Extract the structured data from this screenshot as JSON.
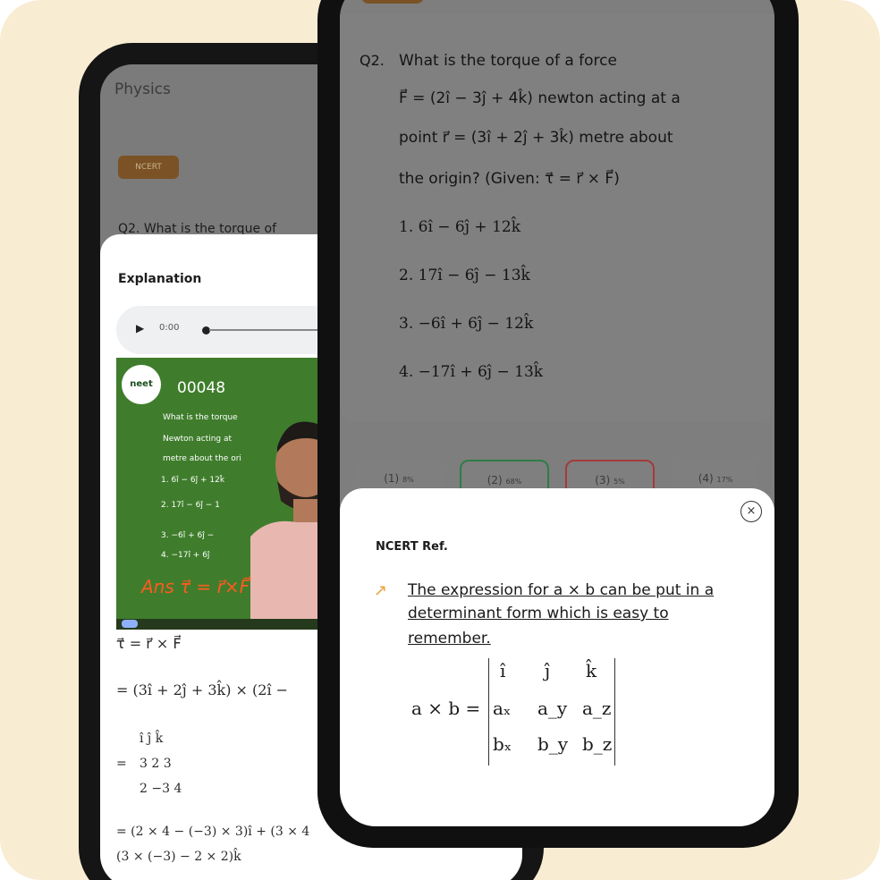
{
  "back_phone": {
    "title": "Physics",
    "badge": "NCERT",
    "question_preview": "Q2. What is the torque of",
    "explanation_title": "Explanation",
    "audio": {
      "play_icon": "play-icon",
      "time": "0:00"
    },
    "video": {
      "logo_text": "neet",
      "number": "00048",
      "lines": [
        "What is the torque ",
        "Newton acting at ",
        "metre about the ori",
        "1. 6î − 6ĵ + 12k̂",
        "2. 17î − 6ĵ − 1",
        "3. −6î + 6ĵ −",
        "4. −17î + 6ĵ"
      ],
      "handwriting": "Ans τ⃗ = r⃗×F⃗"
    },
    "solution": {
      "line1": "τ⃗ = r⃗ × F⃗",
      "line2": "= (3î + 2ĵ + 3k̂) × (2î −",
      "det_row1": "î    ĵ    k̂",
      "det_eq": "=",
      "det_row2": "3    2    3",
      "det_row3": "2   −3   4",
      "line4": "= (2 × 4 − (−3) × 3)î + (3 × 4",
      "line5": "(3 × (−3) − 2 × 2)k̂"
    }
  },
  "front_phone": {
    "question": {
      "number": "Q2.",
      "lines": [
        "What is the torque of a force",
        "F⃗ = (2î − 3ĵ + 4k̂) newton acting at a",
        "point r⃗ = (3î + 2ĵ + 3k̂) metre about",
        "the origin? (Given: τ⃗ = r⃗ × F⃗)"
      ]
    },
    "options": [
      "1. 6î − 6ĵ + 12k̂",
      "2. 17î − 6ĵ − 13k̂",
      "3. −6î + 6ĵ − 12k̂",
      "4. −17î + 6ĵ − 13k̂"
    ],
    "answer_pills": [
      {
        "label": "(1)",
        "pct": "8%"
      },
      {
        "label": "(2)",
        "pct": "68%"
      },
      {
        "label": "(3)",
        "pct": "5%"
      },
      {
        "label": "(4)",
        "pct": "17%"
      }
    ],
    "ref_sheet": {
      "close_icon": "close-icon",
      "title": "NCERT Ref.",
      "link_icon": "external-link-icon",
      "link_lines": [
        "The expression for a × b can be put in a",
        "determinant form which is easy to",
        "remember."
      ],
      "lhs": "a × b =",
      "matrix": [
        [
          "î",
          "ĵ",
          "k̂"
        ],
        [
          "aₓ",
          "a_y",
          "a_z"
        ],
        [
          "bₓ",
          "b_y",
          "b_z"
        ]
      ]
    }
  },
  "colors": {
    "background": "#f8ecd3",
    "badge": "#7a5226",
    "correct": "#2e7d45",
    "wrong": "#a33a3a",
    "link_icon": "#e7a33a"
  }
}
